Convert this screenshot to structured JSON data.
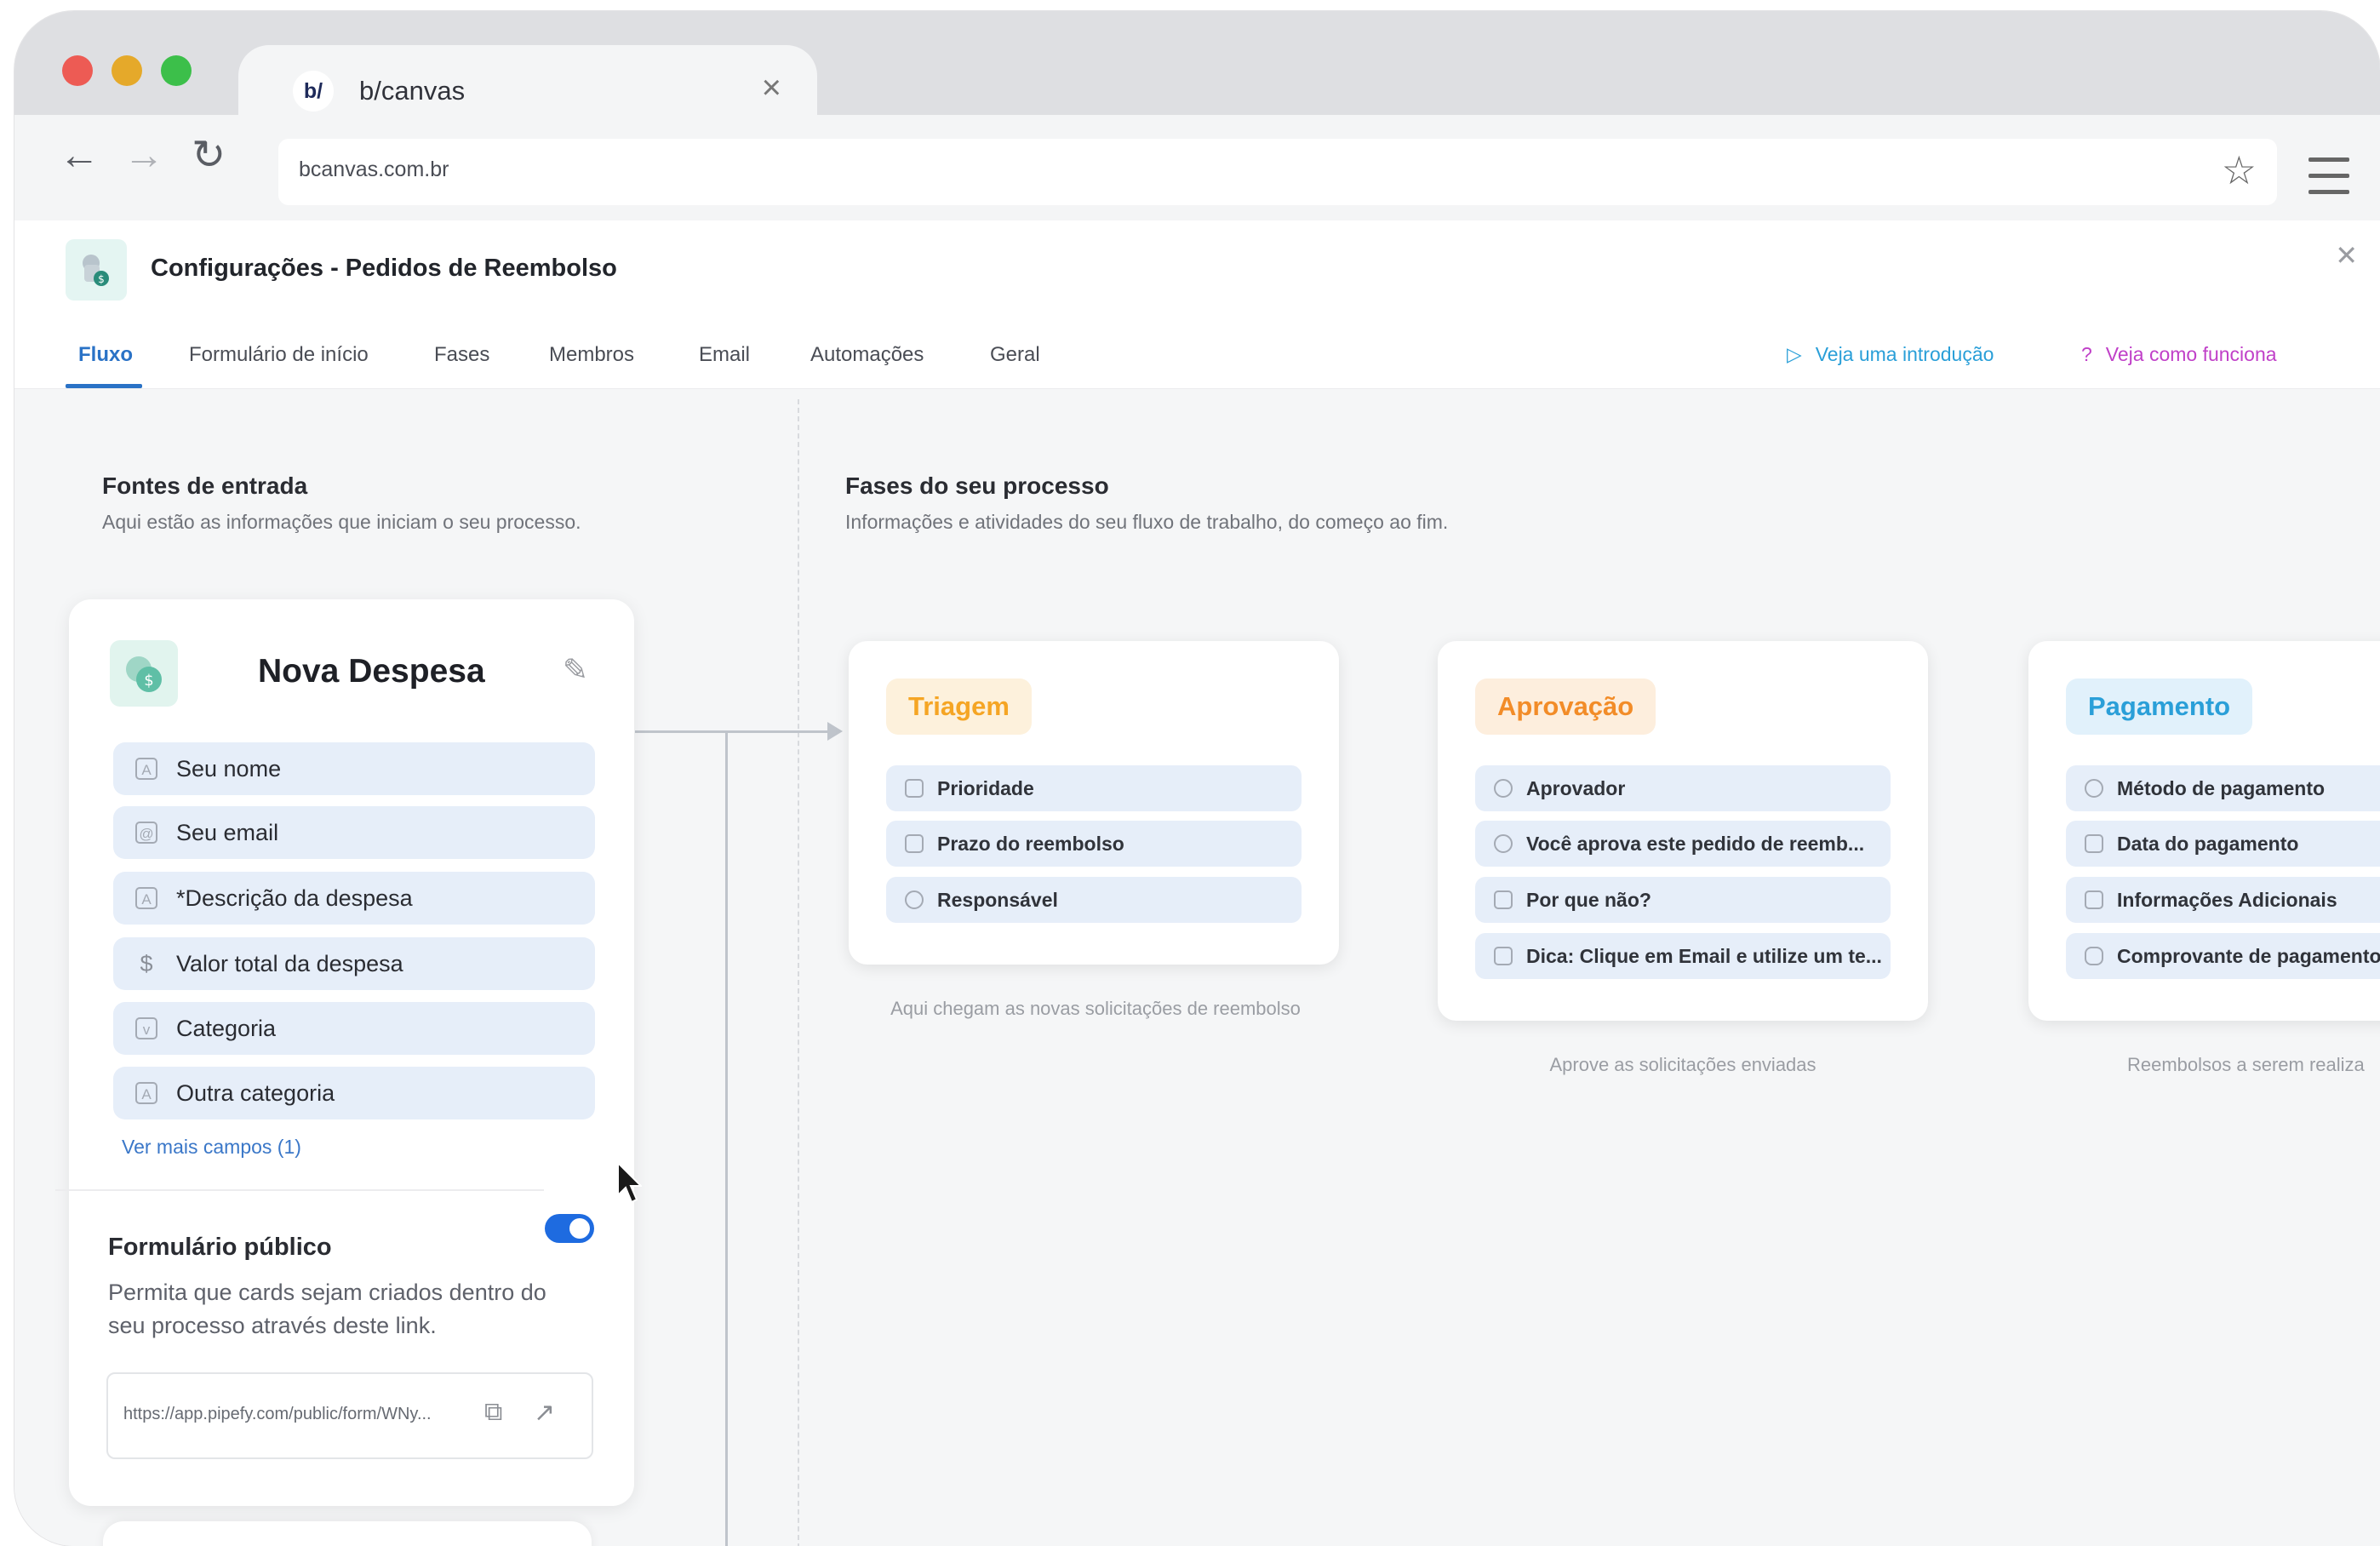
{
  "browser": {
    "tab_logo": "b/",
    "tab_title": "b/canvas",
    "url": "bcanvas.com.br"
  },
  "colors": {
    "accent": "#2a72c6",
    "toggle_on": "#1e6be0",
    "triagem": "#f5a524",
    "aprovacao": "#f28c28",
    "pagamento": "#2a9fd8"
  },
  "icons": [
    "back-arrow-icon",
    "forward-arrow-icon",
    "reload-icon",
    "star-icon",
    "hamburger-menu-icon",
    "close-icon",
    "pencil-icon",
    "copy-icon",
    "external-link-icon",
    "play-icon",
    "help-circle-icon",
    "mouse-pointer-icon"
  ],
  "header": {
    "title": "Configurações - Pedidos de Reembolso"
  },
  "tabs": [
    {
      "label": "Fluxo",
      "active": true
    },
    {
      "label": "Formulário de início"
    },
    {
      "label": "Fases"
    },
    {
      "label": "Membros"
    },
    {
      "label": "Email"
    },
    {
      "label": "Automações"
    },
    {
      "label": "Geral"
    }
  ],
  "help": {
    "intro": "Veja uma introdução",
    "how": "Veja como funciona"
  },
  "sources": {
    "title": "Fontes de entrada",
    "subtitle": "Aqui estão as informações que iniciam o seu processo."
  },
  "phases_section": {
    "title": "Fases do seu processo",
    "subtitle": "Informações e atividades do seu fluxo de trabalho, do começo ao fim."
  },
  "form_card": {
    "title": "Nova Despesa",
    "fields": [
      {
        "label": "Seu nome",
        "icon": "A"
      },
      {
        "label": "Seu email",
        "icon": "@"
      },
      {
        "label": "*Descrição da despesa",
        "icon": "A"
      },
      {
        "label": "Valor total da despesa",
        "icon": "$"
      },
      {
        "label": "Categoria",
        "icon": "v"
      },
      {
        "label": "Outra categoria",
        "icon": "A"
      }
    ],
    "more_fields": "Ver mais campos (1)",
    "public_form_title": "Formulário público",
    "public_form_enabled": true,
    "public_form_desc": "Permita que cards sejam criados dentro do seu processo através deste link.",
    "public_link": "https://app.pipefy.com/public/form/WNy..."
  },
  "phases": [
    {
      "name": "Triagem",
      "fields": [
        "Prioridade",
        "Prazo do reembolso",
        "Responsável"
      ],
      "caption": "Aqui chegam as novas solicitações de reembolso"
    },
    {
      "name": "Aprovação",
      "fields": [
        "Aprovador",
        "Você aprova este pedido de reemb...",
        "Por que não?",
        "Dica: Clique em Email e utilize um te..."
      ],
      "caption": "Aprove as solicitações enviadas"
    },
    {
      "name": "Pagamento",
      "fields": [
        "Método de pagamento",
        "Data do pagamento",
        "Informações Adicionais",
        "Comprovante de pagamento"
      ],
      "caption": "Reembolsos a serem realiza"
    }
  ]
}
